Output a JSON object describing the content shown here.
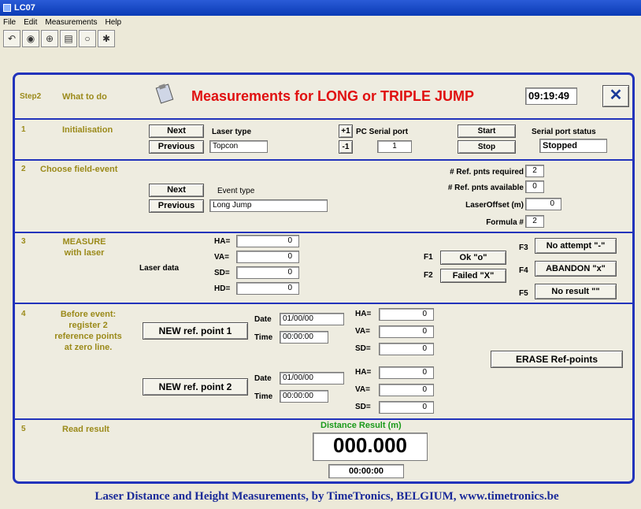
{
  "app_title": "LC07",
  "menu": [
    "File",
    "Edit",
    "Measurements",
    "Help"
  ],
  "toolbar_icons": [
    "undo-icon",
    "camera-icon",
    "connect-icon",
    "printer-icon",
    "stop-icon",
    "tools-icon"
  ],
  "header": {
    "step": "Step2",
    "what": "What to do",
    "title": "Measurements for LONG or TRIPLE JUMP",
    "time": "09:19:49",
    "close": "✕"
  },
  "s1": {
    "num": "1",
    "name": "Initialisation",
    "next": "Next",
    "previous": "Previous",
    "laser_type_label": "Laser type",
    "laser_type": "Topcon",
    "plus": "+1",
    "minus": "-1",
    "pc_port_label": "PC Serial port",
    "pc_port": "1",
    "start": "Start",
    "stop": "Stop",
    "status_label": "Serial port status",
    "status": "Stopped"
  },
  "s2": {
    "num": "2",
    "name": "Choose field-event",
    "next": "Next",
    "previous": "Previous",
    "event_type_label": "Event type",
    "event_type": "Long Jump",
    "req_label": "# Ref. pnts required",
    "req": "2",
    "avail_label": "# Ref. pnts available",
    "avail": "0",
    "offset_label": "LaserOffset (m)",
    "offset": "0",
    "formula_label": "Formula #",
    "formula": "2"
  },
  "s3": {
    "num": "3",
    "name1": "MEASURE",
    "name2": "with laser",
    "laser_data": "Laser data",
    "ha_label": "HA=",
    "ha": "0",
    "va_label": "VA=",
    "va": "0",
    "sd_label": "SD=",
    "sd": "0",
    "hd_label": "HD=",
    "hd": "0",
    "f1": "F1",
    "ok": "Ok \"o\"",
    "f2": "F2",
    "failed": "Failed \"X\"",
    "f3": "F3",
    "no_attempt": "No attempt \"-\"",
    "f4": "F4",
    "abandon": "ABANDON \"x\"",
    "f5": "F5",
    "no_result": "No result \"\""
  },
  "s4": {
    "num": "4",
    "name1": "Before event:",
    "name2": "register 2",
    "name3": "reference points",
    "name4": "at zero line.",
    "ref1": "NEW ref. point 1",
    "ref2": "NEW ref. point 2",
    "date_label": "Date",
    "time_label": "Time",
    "date1": "01/00/00",
    "time1": "00:00:00",
    "date2": "01/00/00",
    "time2": "00:00:00",
    "ha_label": "HA=",
    "va_label": "VA=",
    "sd_label": "SD=",
    "ha1": "0",
    "va1": "0",
    "sd1": "0",
    "ha2": "0",
    "va2": "0",
    "sd2": "0",
    "erase": "ERASE Ref-points"
  },
  "s5": {
    "num": "5",
    "name": "Read result",
    "dist_label": "Distance Result (m)",
    "dist": "000.000",
    "time": "00:00:00"
  },
  "footer": "Laser Distance and Height Measurements, by TimeTronics, BELGIUM, www.timetronics.be",
  "colors": {
    "panel_border": "#2233bb",
    "title_red": "#e01010",
    "olive": "#9b8a1a",
    "green": "#1a9a1a",
    "footer_blue": "#1a2a99"
  }
}
